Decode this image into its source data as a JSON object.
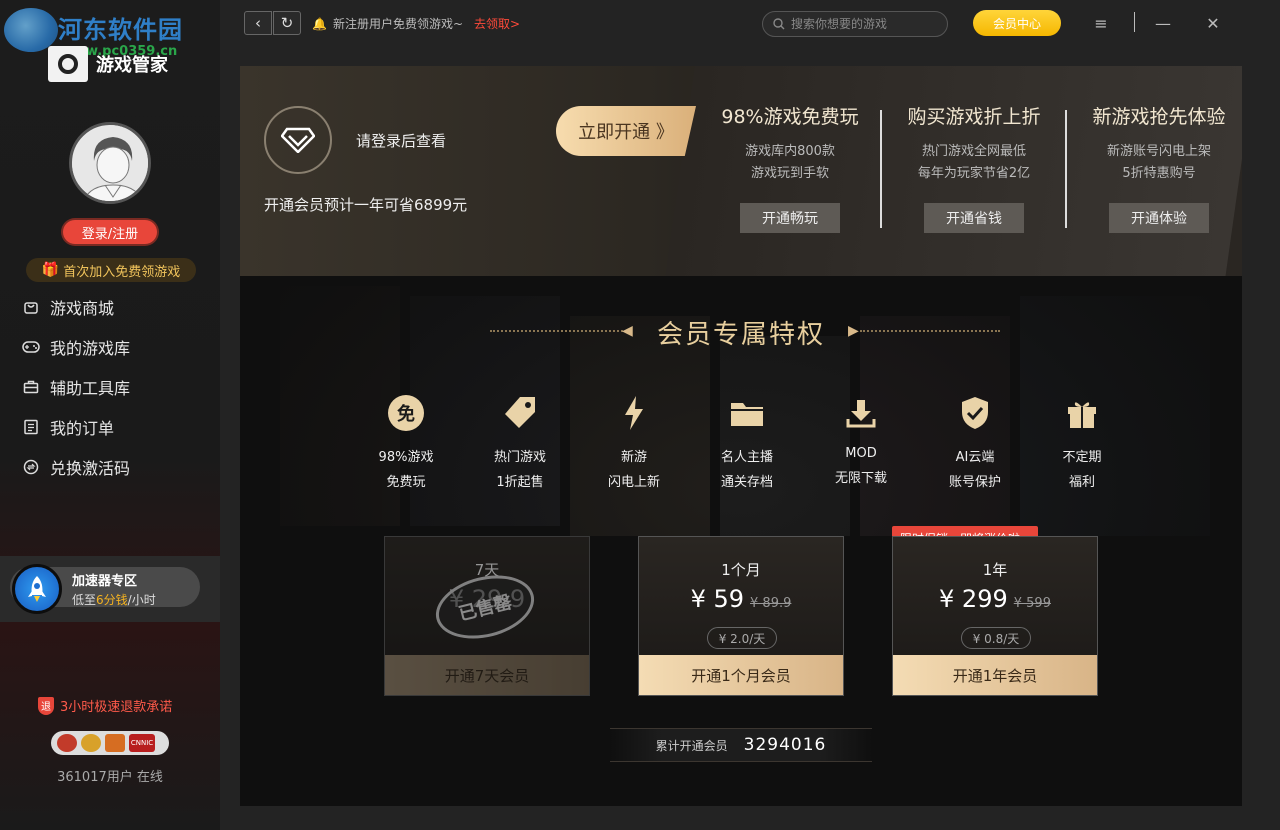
{
  "watermark": {
    "title": "河东软件园",
    "url": "www.pc0359.cn"
  },
  "sidebar": {
    "brand_name": "游戏管家",
    "login_label": "登录/注册",
    "first_join_label": "首次加入免费领游戏",
    "items": [
      {
        "label": "游戏商城",
        "icon": "bag-icon"
      },
      {
        "label": "我的游戏库",
        "icon": "gamepad-icon"
      },
      {
        "label": "辅助工具库",
        "icon": "toolbox-icon"
      },
      {
        "label": "我的订单",
        "icon": "list-icon"
      },
      {
        "label": "兑换激活码",
        "icon": "exchange-icon"
      }
    ],
    "accelerator": {
      "title": "加速器专区",
      "sub_prefix": "低至",
      "sub_highlight": "6分钱",
      "sub_suffix": "/小时"
    },
    "refund_label": "3小时极速退款承诺",
    "refund_icon_text": "退",
    "badge_text": "CNNIC",
    "online_label": "361017用户 在线"
  },
  "topbar": {
    "notice": "新注册用户免费领游戏~",
    "notice_link": "去领取>",
    "search_placeholder": "搜索你想要的游戏",
    "vip_center": "会员中心"
  },
  "banner": {
    "login_hint": "请登录后查看",
    "savings": "开通会员预计一年可省6899元",
    "activate_now": "立即开通 》",
    "benefits": [
      {
        "title": "98%游戏免费玩",
        "desc1": "游戏库内800款",
        "desc2": "游戏玩到手软",
        "button": "开通畅玩"
      },
      {
        "title": "购买游戏折上折",
        "desc1": "热门游戏全网最低",
        "desc2": "每年为玩家节省2亿",
        "button": "开通省钱"
      },
      {
        "title": "新游戏抢先体验",
        "desc1": "新游账号闪电上架",
        "desc2": "5折特惠购号",
        "button": "开通体验"
      }
    ]
  },
  "privileges": {
    "title": "会员专属特权",
    "items": [
      {
        "icon": "free-icon",
        "glyph": "免",
        "line1": "98%游戏",
        "line2": "免费玩"
      },
      {
        "icon": "price-tag-icon",
        "glyph": "",
        "line1": "热门游戏",
        "line2": "1折起售"
      },
      {
        "icon": "lightning-icon",
        "glyph": "",
        "line1": "新游",
        "line2": "闪电上新"
      },
      {
        "icon": "folder-icon",
        "glyph": "",
        "line1": "名人主播",
        "line2": "通关存档"
      },
      {
        "icon": "download-icon",
        "glyph": "",
        "line1": "MOD",
        "line2": "无限下载"
      },
      {
        "icon": "shield-check-icon",
        "glyph": "",
        "line1": "AI云端",
        "line2": "账号保护"
      },
      {
        "icon": "gift-icon",
        "glyph": "",
        "line1": "不定期",
        "line2": "福利"
      }
    ],
    "plans": [
      {
        "name": "7天",
        "price": "¥ 29.9",
        "old": "",
        "daily": "",
        "cta": "开通7天会员",
        "sold": true,
        "stamp": "已售罄"
      },
      {
        "name": "1个月",
        "price": "¥ 59",
        "old": "¥ 89.9",
        "daily": "¥ 2.0/天",
        "cta": "开通1个月会员",
        "sold": false
      },
      {
        "name": "1年",
        "price": "¥ 299",
        "old": "¥ 599",
        "daily": "¥ 0.8/天",
        "cta": "开通1年会员",
        "sold": false
      }
    ],
    "promo_tag": "限时促销，即将涨价啦~",
    "total_label": "累计开通会员",
    "total_value": "3294016"
  },
  "colors": {
    "accent_red": "#e8463a",
    "gold": "#e8cf9e",
    "vip_yellow": "#f5b700"
  }
}
